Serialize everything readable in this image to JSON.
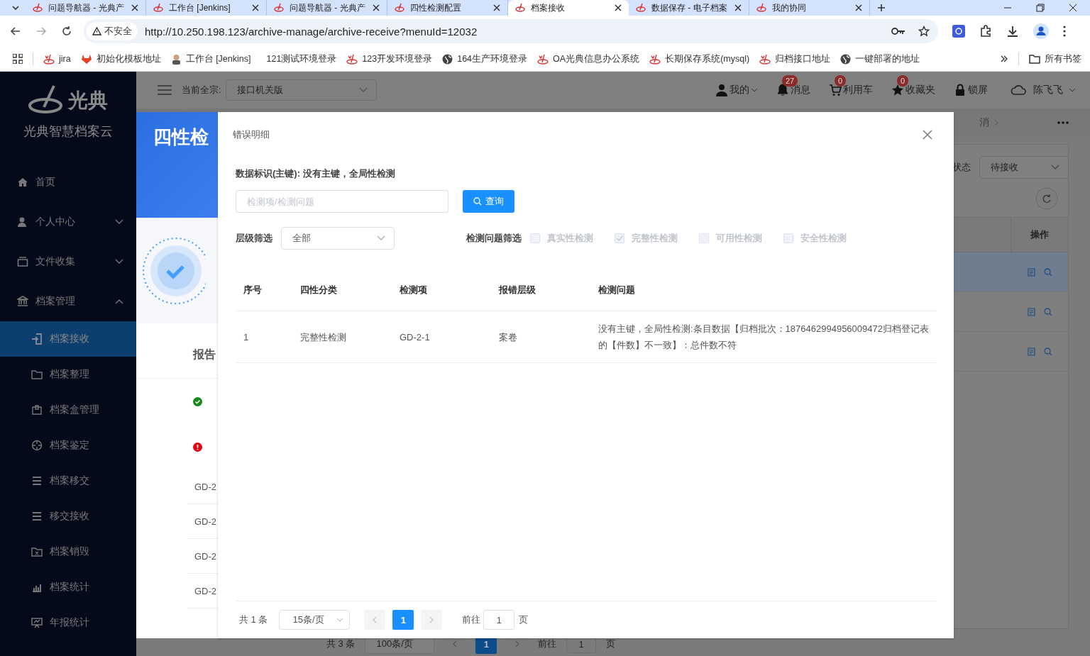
{
  "browser": {
    "tabs": [
      {
        "title": "问题导航器 - 光典产",
        "selected": false
      },
      {
        "title": "工作台 [Jenkins]",
        "selected": false
      },
      {
        "title": "问题导航器 - 光典产",
        "selected": false
      },
      {
        "title": "四性检测配置",
        "selected": false
      },
      {
        "title": "档案接收",
        "selected": true
      },
      {
        "title": "数据保存 - 电子档案",
        "selected": false
      },
      {
        "title": "我的协同",
        "selected": false
      }
    ],
    "address_bar": {
      "security": "不安全",
      "url": "http://10.250.198.123/archive-manage/archive-receive?menuId=12032"
    },
    "bookmarks": [
      {
        "label": "jira"
      },
      {
        "label": "初始化模板地址"
      },
      {
        "label": "工作台 [Jenkins]"
      },
      {
        "label": "121测试环境登录"
      },
      {
        "label": "123开发环境登录"
      },
      {
        "label": "164生产环境登录"
      },
      {
        "label": "OA光典信息办公系统"
      },
      {
        "label": "长期保存系统(mysql)"
      },
      {
        "label": "归档接口地址"
      },
      {
        "label": "一键部署的地址"
      }
    ],
    "all_bookmarks": "所有书签"
  },
  "sidebar": {
    "logo_text": "光典",
    "app_name": "光典智慧档案云",
    "items": [
      {
        "label": "首页",
        "kind": "link",
        "selected": false
      },
      {
        "label": "个人中心",
        "kind": "group",
        "expanded": false
      },
      {
        "label": "文件收集",
        "kind": "group",
        "expanded": false
      },
      {
        "label": "档案管理",
        "kind": "group",
        "expanded": true,
        "children": [
          {
            "label": "档案接收",
            "selected": true
          },
          {
            "label": "档案整理",
            "selected": false
          },
          {
            "label": "档案盒管理",
            "selected": false
          },
          {
            "label": "档案鉴定",
            "selected": false
          },
          {
            "label": "档案移交",
            "selected": false
          },
          {
            "label": "移交接收",
            "selected": false
          },
          {
            "label": "档案销毁",
            "selected": false
          },
          {
            "label": "档案统计",
            "selected": false
          },
          {
            "label": "年报统计",
            "selected": false
          }
        ]
      }
    ]
  },
  "header": {
    "fonds_label": "当前全宗:",
    "fonds_value": "接口机关版",
    "actions": [
      {
        "kind": "user",
        "label": "我的"
      },
      {
        "kind": "bell",
        "label": "消息",
        "badge": "27"
      },
      {
        "kind": "cart",
        "label": "利用车",
        "badge": "0"
      },
      {
        "kind": "star",
        "label": "收藏夹",
        "badge": "0"
      },
      {
        "kind": "lock",
        "label": "锁屏"
      }
    ],
    "user_name": "陈飞飞"
  },
  "background_page": {
    "tab_fragment": "消",
    "status_label": "状态",
    "status_value": "待接收",
    "action_column": "操作",
    "rows": [
      {
        "selected": true
      },
      {
        "selected": false
      },
      {
        "selected": false
      }
    ],
    "pagination": {
      "total": "共 3 条",
      "page_size": "100条/页",
      "page": "1",
      "goto_label": "前往",
      "goto_value": "1",
      "page_suffix": "页"
    }
  },
  "drawer": {
    "title": "四性检",
    "report_heading": "报告",
    "results": [
      {
        "passed": true
      },
      {
        "passed": false
      }
    ],
    "items": [
      "GD-2",
      "GD-2",
      "GD-2",
      "GD-2"
    ]
  },
  "modal": {
    "title": "错误明细",
    "data_id": "数据标识(主键): 没有主键，全局性检测",
    "search": {
      "placeholder": "检测项/检测问题"
    },
    "search_button": "查询",
    "level_filter": {
      "label": "层级筛选",
      "value": "全部"
    },
    "issue_filter": {
      "label": "检测问题筛选",
      "options": [
        {
          "label": "真实性检测",
          "checked": false,
          "disabled": true
        },
        {
          "label": "完整性检测",
          "checked": true,
          "disabled": true
        },
        {
          "label": "可用性检测",
          "checked": false,
          "disabled": true
        },
        {
          "label": "安全性检测",
          "checked": false,
          "disabled": true
        }
      ]
    },
    "table": {
      "columns": [
        "序号",
        "四性分类",
        "检测项",
        "报错层级",
        "检测问题"
      ],
      "rows": [
        {
          "cells": [
            "1",
            "完整性检测",
            "GD-2-1",
            "案卷",
            "没有主键，全局性检测:条目数据【归档批次：1876462994956009472归档登记表的【件数】不一致】：总件数不符"
          ]
        }
      ]
    },
    "pagination": {
      "total": "共 1 条",
      "page_size": "15条/页",
      "pages": [
        {
          "label": "1",
          "selected": true
        }
      ],
      "goto_label": "前往",
      "goto_value": "1",
      "page_suffix": "页"
    }
  }
}
